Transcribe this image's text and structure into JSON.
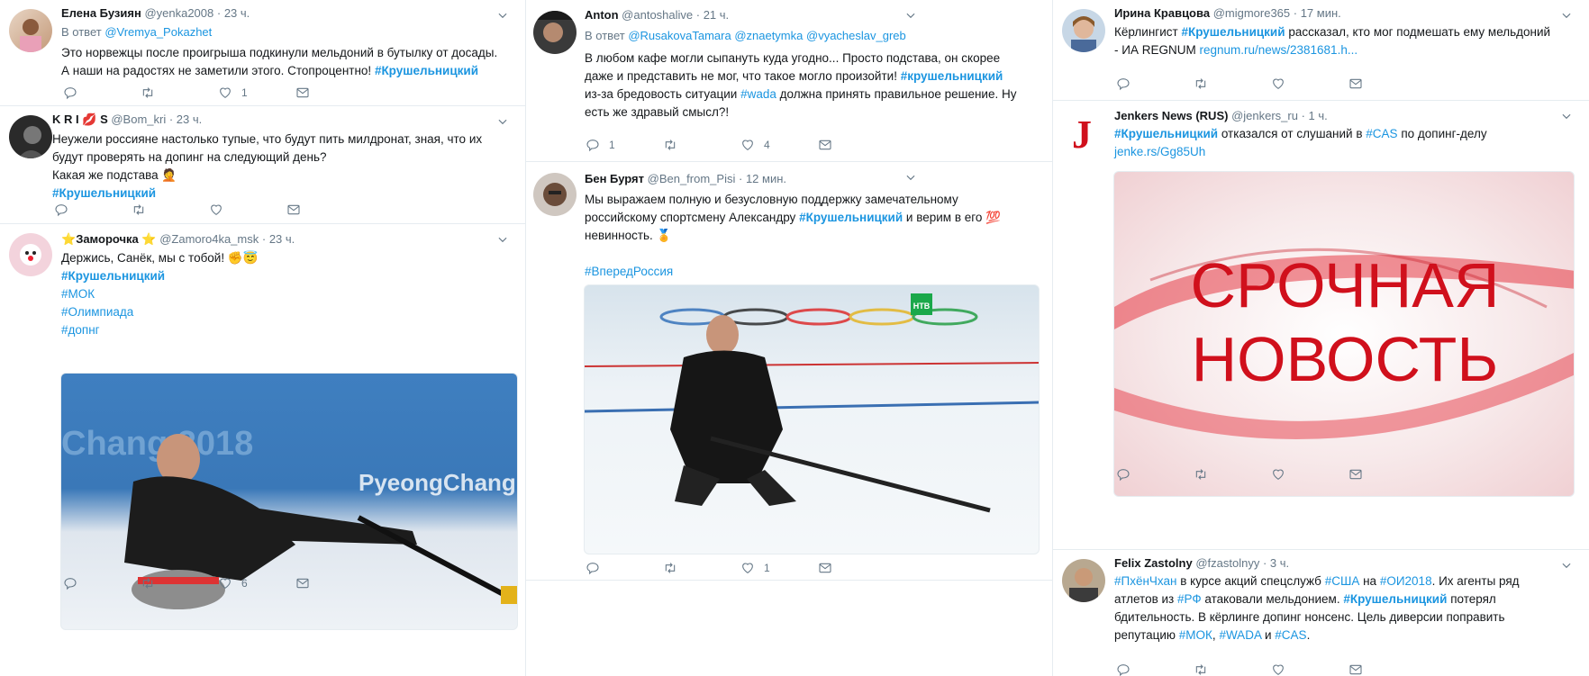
{
  "col1": [
    {
      "name": "Елена Бузиян",
      "handle": "@yenka2008",
      "time": "· 23 ч.",
      "reply_prefix": "В ответ",
      "reply_to": "@Vremya_Pokazhet",
      "line1": "Это норвежцы после проигрыша подкинули мельдоний в бутылку от досады.",
      "line2": "А наши на радостях не заметили этого. Стопроцентно!",
      "tag": "#Крушельницкий",
      "likes": "1"
    },
    {
      "name_a": "K R I",
      "name_b": "S",
      "lips_emoji": "💋",
      "handle": "@Bom_kri",
      "time": "· 23 ч.",
      "line1": "Неужели россияне настолько тупые, что будут пить милдронат, зная, что их",
      "line2": "будут проверять на допинг на следующий день?",
      "line3": "Какая же подстава",
      "facepalm_emoji": "🤦",
      "tag": "#Крушельницкий"
    },
    {
      "star_emoji": "⭐",
      "name": "Заморочка",
      "handle": "@Zamoro4ka_msk",
      "time": "· 23 ч.",
      "line1": "Держись, Санёк, мы с тобой!",
      "emoji": "✊😇",
      "tag1": "#Крушельницкий",
      "tag2": "#МОК",
      "tag3": "#Олимпиада",
      "tag4": "#допнг",
      "image_text_1": "PyeongChang 2018",
      "image_text_2": "Chang 2018",
      "likes": "6"
    }
  ],
  "col2": [
    {
      "name": "Anton",
      "handle": "@antoshalive",
      "time": "· 21 ч.",
      "reply_prefix": "В ответ",
      "reply_to_1": "@RusakovaTamara",
      "reply_to_2": "@znaetymka",
      "reply_to_3": "@vyacheslav_greb",
      "line1": "В любом кафе могли сыпануть куда угодно... Просто подстава, он скорее",
      "line2": "даже и представить не мог, что такое могло произойти!",
      "tag": "#крушельницкий",
      "line3": "из-за бредовость ситуации",
      "tag_wada": "#wada",
      "line3b": "должна принять правильное решение. Ну",
      "line4": "есть же здравый смысл?!",
      "replies": "1",
      "likes": "4"
    },
    {
      "name": "Бен Бурят",
      "handle": "@Ben_from_Pisi",
      "time": "· 12 мин.",
      "line1": "Мы выражаем полную и безусловную поддержку замечательному",
      "line2": "российскому спортсмену Александру",
      "tag": "#Крушельницкий",
      "line2b": "и верим в его",
      "hundred_emoji": "💯",
      "line3": "невинность.",
      "medal_emoji": "🏅",
      "tag2": "#ВпередРоссия",
      "ntv_logo": "НТВ",
      "likes": "1"
    }
  ],
  "col3": [
    {
      "name": "Ирина Кравцова",
      "handle": "@migmore365",
      "time": "· 17 мин.",
      "line1a": "Кёрлингист",
      "tag": "#Крушельницкий",
      "line1b": "рассказал, кто мог подмешать ему мельдоний",
      "line2": "- ИА REGNUM",
      "link": "regnum.ru/news/2381681.h..."
    },
    {
      "name": "Jenkers News (RUS)",
      "handle": "@jenkers_ru",
      "time": "· 1 ч.",
      "avatar_letter": "J",
      "tag": "#Крушельницкий",
      "line1": "отказался от слушаний в",
      "tag_cas": "#CAS",
      "line1b": "по допинг-делу",
      "link": "jenke.rs/Gg85Uh",
      "card_line1": "СРОЧНАЯ",
      "card_line2": "НОВОСТЬ"
    },
    {
      "name": "Felix Zastolny",
      "handle": "@fzastolnyy",
      "time": "· 3 ч.",
      "tag_pc": "#ПхёнЧхан",
      "t1": "в курсе акций спецслужб",
      "tag_usa": "#США",
      "t2": "на",
      "tag_oi": "#ОИ2018",
      "t3": ". Их агенты ряд",
      "t4": "атлетов из",
      "tag_rf": "#РФ",
      "t5": "атаковали мельдонием.",
      "tag_k": "#Крушельницкий",
      "t6": "потерял",
      "t7": "бдительность. В кёрлинге допинг нонсенс. Цель диверсии поправить",
      "t8": "репутацию",
      "tag_mok": "#МОК",
      "t9": ",",
      "tag_wada": "#WADA",
      "t10": "и",
      "tag_cas": "#CAS",
      "t11": "."
    }
  ],
  "colors": {
    "link": "#1b95e0",
    "muted": "#657786",
    "border": "#e6ecf0",
    "news_red": "#d0101c"
  },
  "icons": [
    "reply-icon",
    "retweet-icon",
    "like-icon",
    "direct-message-icon",
    "caret-down-icon"
  ]
}
